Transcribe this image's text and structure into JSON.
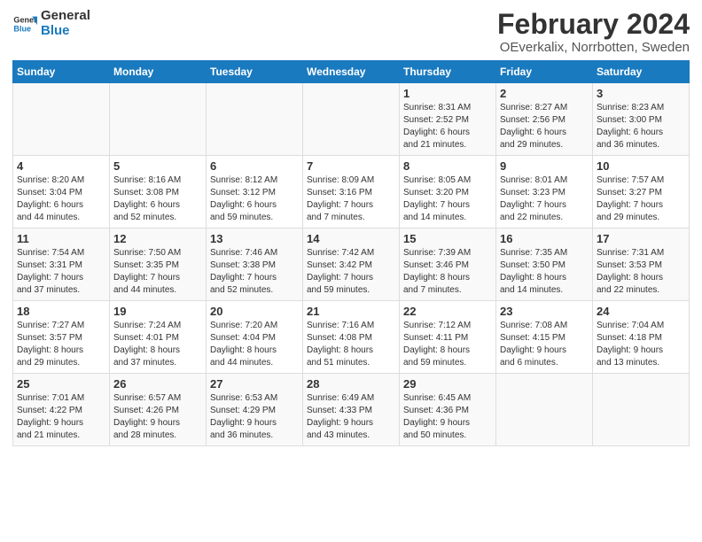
{
  "logo": {
    "line1": "General",
    "line2": "Blue"
  },
  "title": "February 2024",
  "subtitle": "OEverkalix, Norrbotten, Sweden",
  "headers": [
    "Sunday",
    "Monday",
    "Tuesday",
    "Wednesday",
    "Thursday",
    "Friday",
    "Saturday"
  ],
  "weeks": [
    [
      {
        "day": "",
        "info": ""
      },
      {
        "day": "",
        "info": ""
      },
      {
        "day": "",
        "info": ""
      },
      {
        "day": "",
        "info": ""
      },
      {
        "day": "1",
        "info": "Sunrise: 8:31 AM\nSunset: 2:52 PM\nDaylight: 6 hours\nand 21 minutes."
      },
      {
        "day": "2",
        "info": "Sunrise: 8:27 AM\nSunset: 2:56 PM\nDaylight: 6 hours\nand 29 minutes."
      },
      {
        "day": "3",
        "info": "Sunrise: 8:23 AM\nSunset: 3:00 PM\nDaylight: 6 hours\nand 36 minutes."
      }
    ],
    [
      {
        "day": "4",
        "info": "Sunrise: 8:20 AM\nSunset: 3:04 PM\nDaylight: 6 hours\nand 44 minutes."
      },
      {
        "day": "5",
        "info": "Sunrise: 8:16 AM\nSunset: 3:08 PM\nDaylight: 6 hours\nand 52 minutes."
      },
      {
        "day": "6",
        "info": "Sunrise: 8:12 AM\nSunset: 3:12 PM\nDaylight: 6 hours\nand 59 minutes."
      },
      {
        "day": "7",
        "info": "Sunrise: 8:09 AM\nSunset: 3:16 PM\nDaylight: 7 hours\nand 7 minutes."
      },
      {
        "day": "8",
        "info": "Sunrise: 8:05 AM\nSunset: 3:20 PM\nDaylight: 7 hours\nand 14 minutes."
      },
      {
        "day": "9",
        "info": "Sunrise: 8:01 AM\nSunset: 3:23 PM\nDaylight: 7 hours\nand 22 minutes."
      },
      {
        "day": "10",
        "info": "Sunrise: 7:57 AM\nSunset: 3:27 PM\nDaylight: 7 hours\nand 29 minutes."
      }
    ],
    [
      {
        "day": "11",
        "info": "Sunrise: 7:54 AM\nSunset: 3:31 PM\nDaylight: 7 hours\nand 37 minutes."
      },
      {
        "day": "12",
        "info": "Sunrise: 7:50 AM\nSunset: 3:35 PM\nDaylight: 7 hours\nand 44 minutes."
      },
      {
        "day": "13",
        "info": "Sunrise: 7:46 AM\nSunset: 3:38 PM\nDaylight: 7 hours\nand 52 minutes."
      },
      {
        "day": "14",
        "info": "Sunrise: 7:42 AM\nSunset: 3:42 PM\nDaylight: 7 hours\nand 59 minutes."
      },
      {
        "day": "15",
        "info": "Sunrise: 7:39 AM\nSunset: 3:46 PM\nDaylight: 8 hours\nand 7 minutes."
      },
      {
        "day": "16",
        "info": "Sunrise: 7:35 AM\nSunset: 3:50 PM\nDaylight: 8 hours\nand 14 minutes."
      },
      {
        "day": "17",
        "info": "Sunrise: 7:31 AM\nSunset: 3:53 PM\nDaylight: 8 hours\nand 22 minutes."
      }
    ],
    [
      {
        "day": "18",
        "info": "Sunrise: 7:27 AM\nSunset: 3:57 PM\nDaylight: 8 hours\nand 29 minutes."
      },
      {
        "day": "19",
        "info": "Sunrise: 7:24 AM\nSunset: 4:01 PM\nDaylight: 8 hours\nand 37 minutes."
      },
      {
        "day": "20",
        "info": "Sunrise: 7:20 AM\nSunset: 4:04 PM\nDaylight: 8 hours\nand 44 minutes."
      },
      {
        "day": "21",
        "info": "Sunrise: 7:16 AM\nSunset: 4:08 PM\nDaylight: 8 hours\nand 51 minutes."
      },
      {
        "day": "22",
        "info": "Sunrise: 7:12 AM\nSunset: 4:11 PM\nDaylight: 8 hours\nand 59 minutes."
      },
      {
        "day": "23",
        "info": "Sunrise: 7:08 AM\nSunset: 4:15 PM\nDaylight: 9 hours\nand 6 minutes."
      },
      {
        "day": "24",
        "info": "Sunrise: 7:04 AM\nSunset: 4:18 PM\nDaylight: 9 hours\nand 13 minutes."
      }
    ],
    [
      {
        "day": "25",
        "info": "Sunrise: 7:01 AM\nSunset: 4:22 PM\nDaylight: 9 hours\nand 21 minutes."
      },
      {
        "day": "26",
        "info": "Sunrise: 6:57 AM\nSunset: 4:26 PM\nDaylight: 9 hours\nand 28 minutes."
      },
      {
        "day": "27",
        "info": "Sunrise: 6:53 AM\nSunset: 4:29 PM\nDaylight: 9 hours\nand 36 minutes."
      },
      {
        "day": "28",
        "info": "Sunrise: 6:49 AM\nSunset: 4:33 PM\nDaylight: 9 hours\nand 43 minutes."
      },
      {
        "day": "29",
        "info": "Sunrise: 6:45 AM\nSunset: 4:36 PM\nDaylight: 9 hours\nand 50 minutes."
      },
      {
        "day": "",
        "info": ""
      },
      {
        "day": "",
        "info": ""
      }
    ]
  ]
}
